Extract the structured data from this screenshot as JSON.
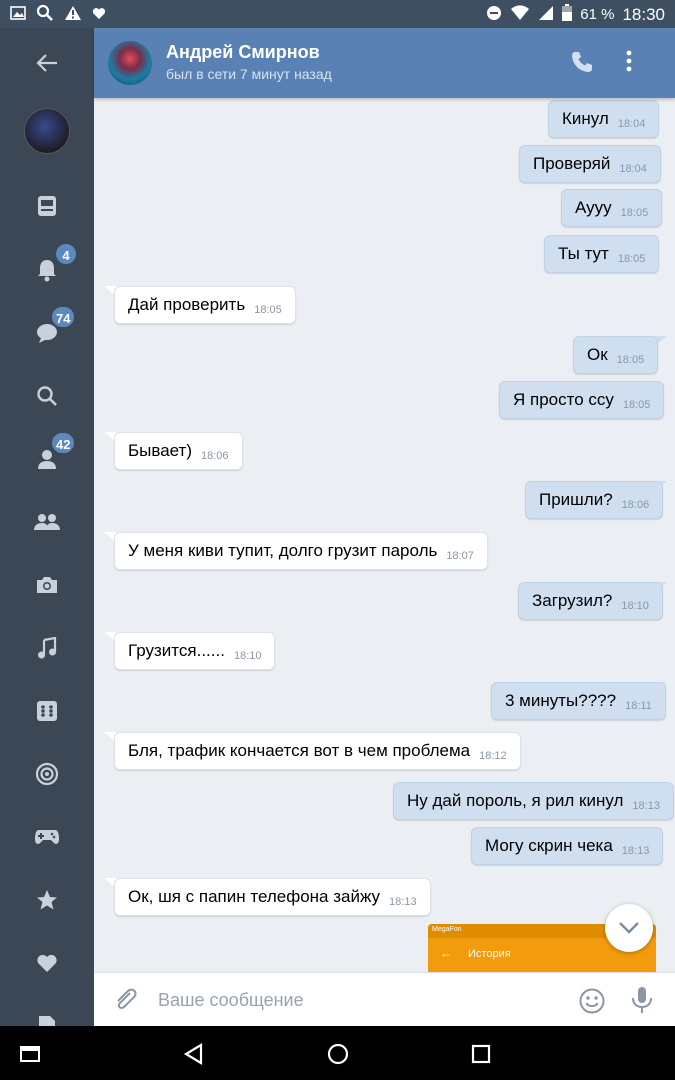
{
  "status_bar": {
    "battery": "61 %",
    "time": "18:30"
  },
  "sidebar": {
    "badges": {
      "notifications": "4",
      "messages": "74",
      "friends": "42"
    }
  },
  "header": {
    "name": "Андрей Смирнов",
    "status": "был в сети 7 минут назад"
  },
  "messages": [
    {
      "dir": "out",
      "text": "Кинул",
      "time": "18:04"
    },
    {
      "dir": "out",
      "text": "Проверяй",
      "time": "18:04"
    },
    {
      "dir": "out",
      "text": "Ауyy",
      "time": "18:05"
    },
    {
      "dir": "out",
      "text": "Ты тут",
      "time": "18:05"
    },
    {
      "dir": "in",
      "text": "Дай проверить",
      "time": "18:05"
    },
    {
      "dir": "out",
      "text": "Ок",
      "time": "18:05"
    },
    {
      "dir": "out",
      "text": "Я просто ссу",
      "time": "18:05"
    },
    {
      "dir": "in",
      "text": "Бывает)",
      "time": "18:06"
    },
    {
      "dir": "out",
      "text": "Пришли?",
      "time": "18:06"
    },
    {
      "dir": "in",
      "text": "У меня киви тупит, долго грузит пароль",
      "time": "18:07"
    },
    {
      "dir": "out",
      "text": "Загрузил?",
      "time": "18:10"
    },
    {
      "dir": "in",
      "text": "Грузится......",
      "time": "18:10"
    },
    {
      "dir": "out",
      "text": "3 минуты????",
      "time": "18:11"
    },
    {
      "dir": "in",
      "text": "Бля, трафик кончается вот в чем проблема",
      "time": "18:12"
    },
    {
      "dir": "out",
      "text": "Ну дай пороль, я рил кинул",
      "time": "18:13"
    },
    {
      "dir": "out",
      "text": "Могу скрин чека",
      "time": "18:13"
    },
    {
      "dir": "in",
      "text": "Ок, шя с папин телефона зайжу",
      "time": "18:13"
    }
  ],
  "attachment": {
    "title": "История",
    "carrier": "MegaFon"
  },
  "input": {
    "placeholder": "Ваше сообщение"
  }
}
